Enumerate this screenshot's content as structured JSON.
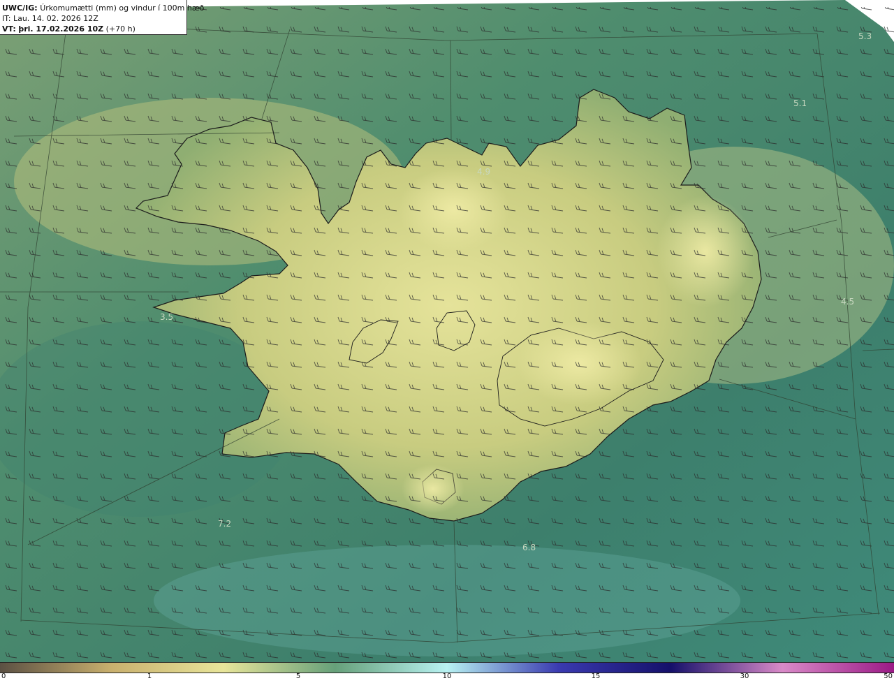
{
  "header": {
    "product": "UWC/IG:",
    "description": "Úrkomumætti (mm) og vindur í 100m hæð",
    "init_time": "IT: Lau. 14. 02. 2026 12Z",
    "valid_prefix": "VT:",
    "valid_time": "þri. 17.02.2026 10Z",
    "lead": "(+70 h)"
  },
  "map_labels": [
    {
      "text": "5.3",
      "name": "label-northeast-sea"
    },
    {
      "text": "5.1",
      "name": "label-northeast-offshore"
    },
    {
      "text": "4.9",
      "name": "label-north-iceland"
    },
    {
      "text": "3.5",
      "name": "label-west-coast"
    },
    {
      "text": "4.5",
      "name": "label-east-sea"
    },
    {
      "text": "7.2",
      "name": "label-southwest-sea"
    },
    {
      "text": "6.8",
      "name": "label-south-sea"
    }
  ],
  "colorbar": {
    "ticks": [
      "0",
      "1",
      "5",
      "10",
      "15",
      "30",
      "50"
    ],
    "colors": [
      "#5b5043",
      "#c9b06e",
      "#e8e59a",
      "#66a07a",
      "#b8f2f2",
      "#3a3ab0",
      "#15106a",
      "#d98ac8",
      "#9b1a86"
    ]
  },
  "colors": {
    "land": "#c9cc7e",
    "sea": "#3f7e6a",
    "coast": "#1b1b1b",
    "graticule": "#3a4a3a"
  }
}
